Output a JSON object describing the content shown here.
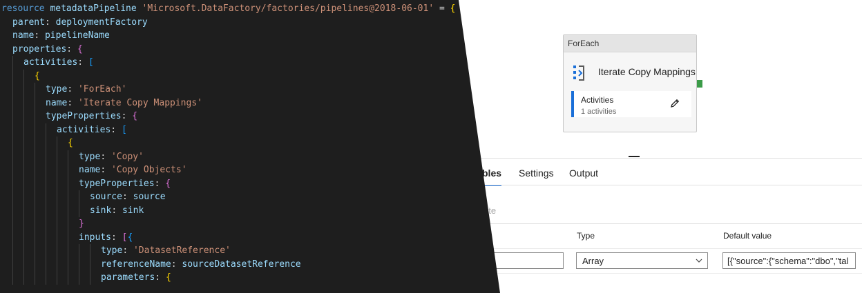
{
  "foreach": {
    "header": "ForEach",
    "name": "Iterate Copy Mappings",
    "activities_label": "Activities",
    "activities_count": "1 activities"
  },
  "tabs": [
    {
      "label": "bles",
      "active": true
    },
    {
      "label": "Settings",
      "active": false
    },
    {
      "label": "Output",
      "active": false
    }
  ],
  "toolbar": {
    "delete_label": "ete"
  },
  "table": {
    "headers": [
      "Type",
      "Default value"
    ],
    "row": {
      "name_value": "",
      "type_value": "Array",
      "default_value": "[{\"source\":{\"schema\":\"dbo\",\"tal"
    }
  },
  "code": {
    "lines": [
      [
        [
          "kw",
          "resource "
        ],
        [
          "id",
          "metadataPipeline "
        ],
        [
          "str",
          "'Microsoft.DataFactory/factories/pipelines@2018-06-01'"
        ],
        [
          "punc",
          " = "
        ],
        [
          "b1",
          "{"
        ]
      ],
      [
        [
          "prop",
          "parent"
        ],
        [
          "punc",
          ": "
        ],
        [
          "id",
          "deploymentFactory"
        ]
      ],
      [
        [
          "prop",
          "name"
        ],
        [
          "punc",
          ": "
        ],
        [
          "id",
          "pipelineName"
        ]
      ],
      [
        [
          "prop",
          "properties"
        ],
        [
          "punc",
          ": "
        ],
        [
          "b2",
          "{"
        ]
      ],
      [
        [
          "prop",
          "activities"
        ],
        [
          "punc",
          ": "
        ],
        [
          "b3",
          "["
        ]
      ],
      [
        [
          "b1",
          "{"
        ]
      ],
      [
        [
          "prop",
          "type"
        ],
        [
          "punc",
          ": "
        ],
        [
          "str",
          "'ForEach'"
        ]
      ],
      [
        [
          "prop",
          "name"
        ],
        [
          "punc",
          ": "
        ],
        [
          "str",
          "'Iterate Copy Mappings'"
        ]
      ],
      [
        [
          "prop",
          "typeProperties"
        ],
        [
          "punc",
          ": "
        ],
        [
          "b2",
          "{"
        ]
      ],
      [
        [
          "prop",
          "activities"
        ],
        [
          "punc",
          ": "
        ],
        [
          "b3",
          "["
        ]
      ],
      [
        [
          "b1",
          "{"
        ]
      ],
      [
        [
          "prop",
          "type"
        ],
        [
          "punc",
          ": "
        ],
        [
          "str",
          "'Copy'"
        ]
      ],
      [
        [
          "prop",
          "name"
        ],
        [
          "punc",
          ": "
        ],
        [
          "str",
          "'Copy Objects'"
        ]
      ],
      [
        [
          "prop",
          "typeProperties"
        ],
        [
          "punc",
          ": "
        ],
        [
          "b2",
          "{"
        ]
      ],
      [
        [
          "prop",
          "source"
        ],
        [
          "punc",
          ": "
        ],
        [
          "id",
          "source"
        ]
      ],
      [
        [
          "prop",
          "sink"
        ],
        [
          "punc",
          ": "
        ],
        [
          "id",
          "sink"
        ]
      ],
      [
        [
          "b2",
          "}"
        ]
      ],
      [
        [
          "prop",
          "inputs"
        ],
        [
          "punc",
          ": "
        ],
        [
          "b2",
          "["
        ],
        [
          "b3",
          "{"
        ]
      ],
      [
        [
          "prop",
          "type"
        ],
        [
          "punc",
          ": "
        ],
        [
          "str",
          "'DatasetReference'"
        ]
      ],
      [
        [
          "prop",
          "referenceName"
        ],
        [
          "punc",
          ": "
        ],
        [
          "id",
          "sourceDatasetReference"
        ]
      ],
      [
        [
          "prop",
          "parameters"
        ],
        [
          "punc",
          ": "
        ],
        [
          "b1",
          "{"
        ]
      ]
    ]
  },
  "colors": {
    "editor_bg": "#1e1e1e",
    "accent": "#1a6fd8",
    "port": "#3b9b48"
  },
  "icons": [
    "foreach-icon",
    "pencil-icon",
    "chevron-down-icon"
  ]
}
